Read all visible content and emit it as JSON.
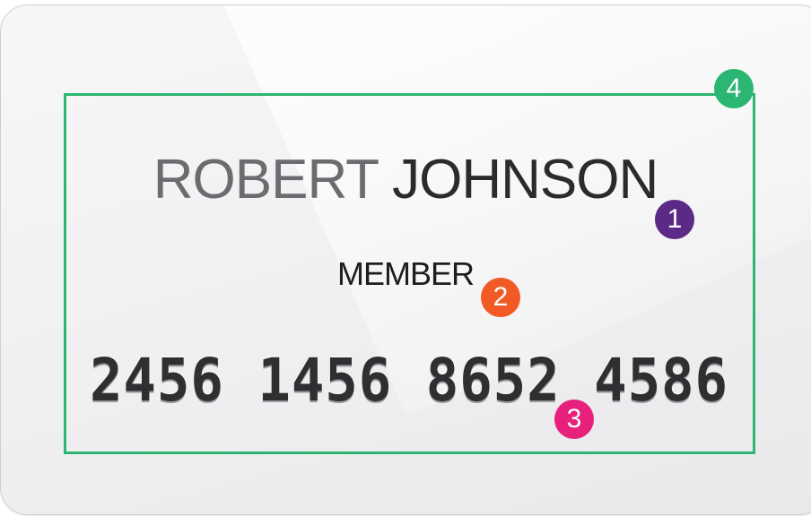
{
  "card": {
    "holder_first_name": "ROBERT",
    "holder_last_name": "JOHNSON",
    "holder_role": "MEMBER",
    "number": "2456 1456 8652 4586"
  },
  "callouts": [
    {
      "label": "1",
      "color": "#5b2a86"
    },
    {
      "label": "2",
      "color": "#f15a24"
    },
    {
      "label": "3",
      "color": "#e6207b"
    },
    {
      "label": "4",
      "color": "#2bb673"
    }
  ],
  "colors": {
    "frame": "#2bb673",
    "card_background": "#f1f1f2",
    "text_dark": "#2b2b2d"
  }
}
